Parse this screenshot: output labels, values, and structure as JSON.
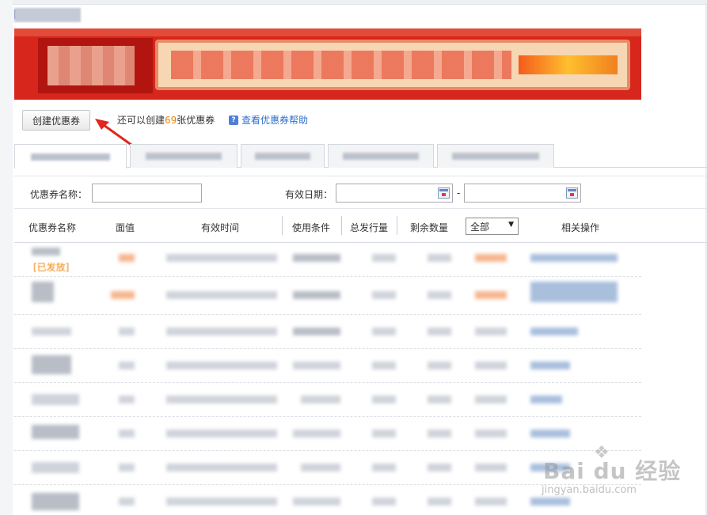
{
  "toolbar": {
    "create_button_label": "创建优惠券",
    "remaining_prefix": "还可以创建",
    "remaining_count": "69",
    "remaining_suffix": "张优惠券",
    "help_link_label": "查看优惠券帮助",
    "help_icon": "?"
  },
  "filters": {
    "name_label": "优惠券名称：",
    "name_value": "",
    "date_label": "有效日期：",
    "date_start_value": "",
    "date_end_value": "",
    "date_separator": "-"
  },
  "table": {
    "columns": [
      "优惠券名称",
      "面值",
      "有效时间",
      "使用条件",
      "总发行量",
      "剩余数量",
      "相关操作"
    ],
    "status_filter": {
      "selected": "全部",
      "caret": "▼"
    },
    "first_row_status_text": "[已发放]"
  },
  "watermark": {
    "brand": "Bai du 经验",
    "paw": "❖",
    "url": "jingyan.baidu.com"
  },
  "colors": {
    "accent_orange": "#f08300",
    "link_blue": "#2c6fcf",
    "banner_red": "#d7261c",
    "annotation_arrow": "#e0261f"
  }
}
